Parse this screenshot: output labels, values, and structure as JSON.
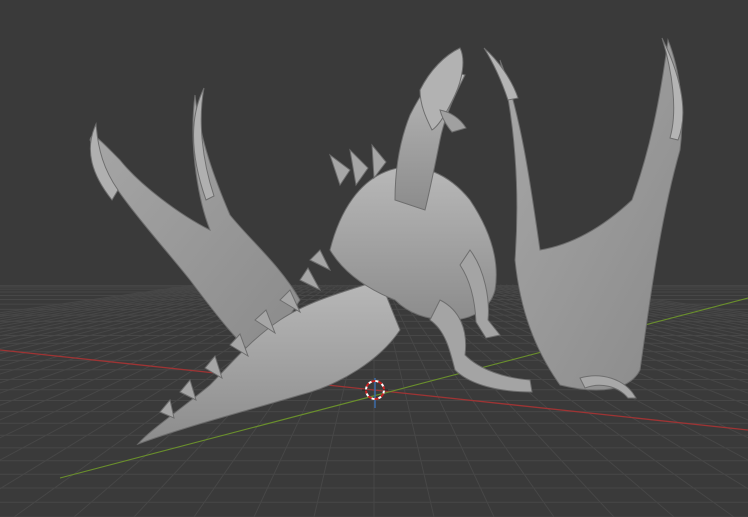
{
  "viewport": {
    "background": "#3a3a3a",
    "grid_color": "#4a4a4a",
    "x_axis_color": "#b33a3a",
    "y_axis_color": "#6b9a2a",
    "z_axis_color": "#3a6aa8",
    "cursor_colors": [
      "#cc2222",
      "#ffffff"
    ]
  },
  "scene": {
    "object": "dragon sculpt",
    "object_color": "#9a9a9a",
    "gizmo": "3d-cursor-icon"
  }
}
